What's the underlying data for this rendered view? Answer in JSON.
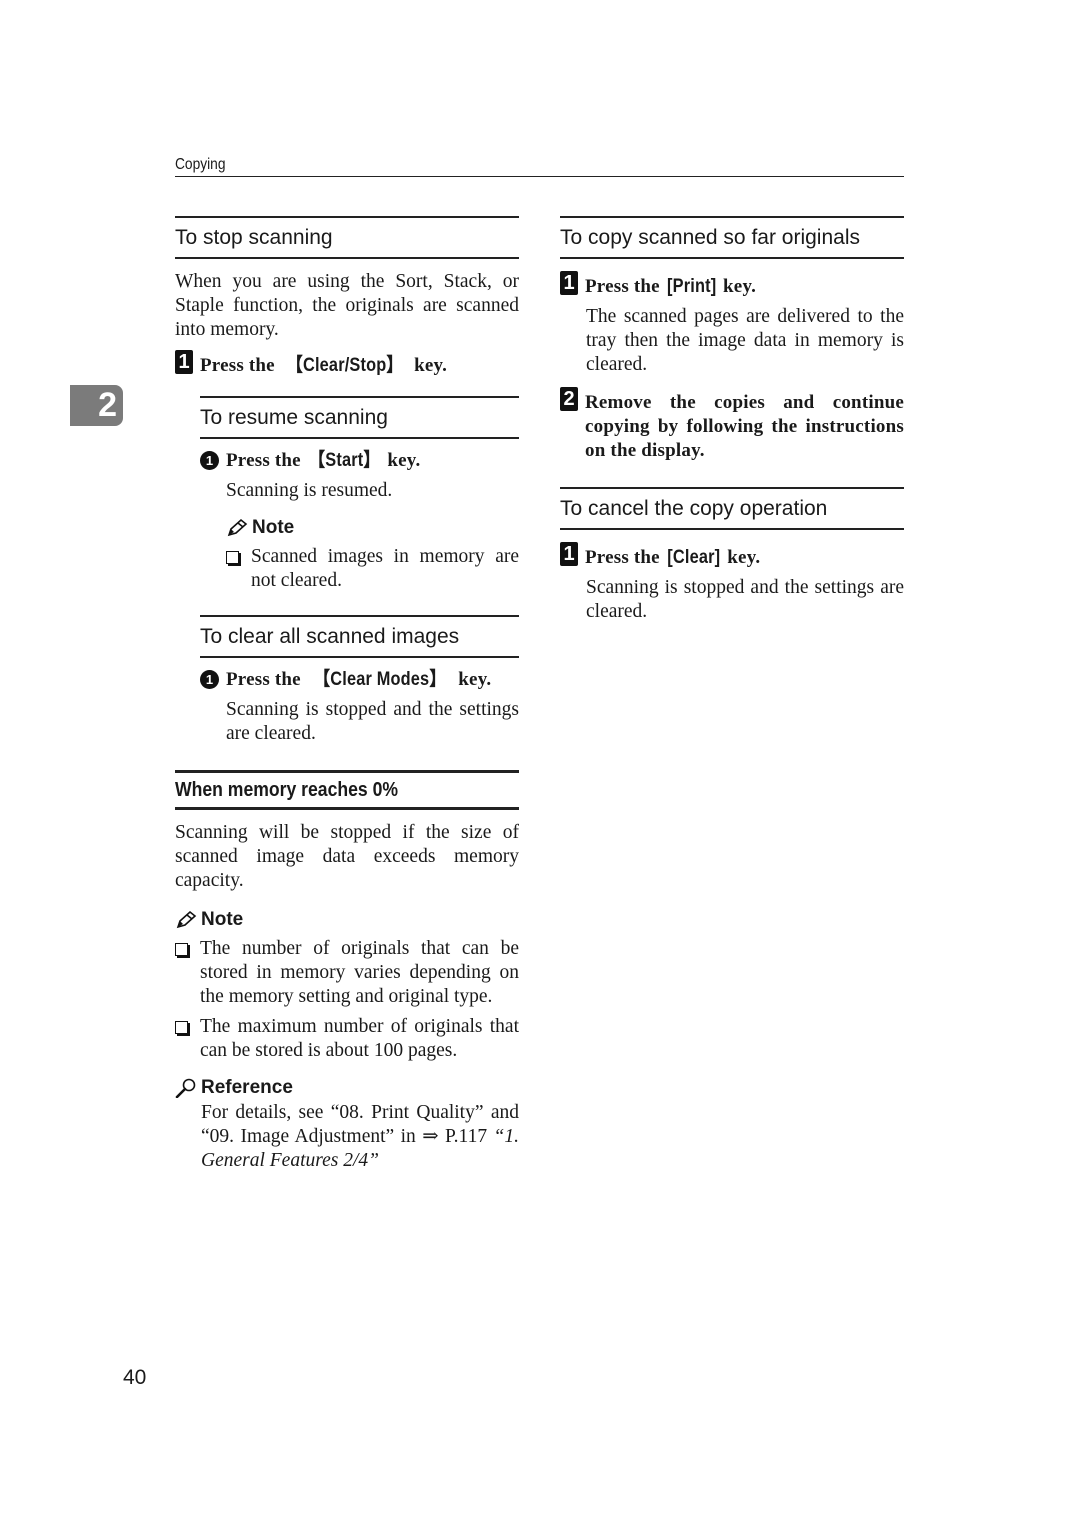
{
  "running_head": "Copying",
  "chapter_tab": "2",
  "page_number": "40",
  "left_column": {
    "stop_scanning": {
      "heading": "To stop scanning",
      "intro": "When you are using the Sort, Stack, or Staple function, the originals are scanned into memory.",
      "step1": {
        "num": "1",
        "prefix": "Press the ",
        "key": "【Clear/Stop】",
        "suffix": " key."
      }
    },
    "resume_scanning": {
      "heading": "To resume scanning",
      "step1": {
        "num": "1",
        "prefix": "Press the ",
        "key": "【Start】",
        "suffix": " key."
      },
      "result": "Scanning is resumed.",
      "note_label": "Note",
      "note_items": [
        "Scanned images in memory are not cleared."
      ]
    },
    "clear_all": {
      "heading": "To clear all scanned images",
      "step1": {
        "num": "1",
        "prefix": "Press the ",
        "key": "【Clear Modes】",
        "suffix": " key."
      },
      "result": "Scanning is stopped and the settings are cleared."
    },
    "memory_zero": {
      "heading": "When memory reaches 0%",
      "intro": "Scanning will be stopped if the size of scanned image data exceeds memory capacity.",
      "note_label": "Note",
      "note_items": [
        "The number of originals that can be stored in memory varies depending on the memory setting and original type.",
        "The maximum number of originals that can be stored is about 100 pages."
      ],
      "reference_label": "Reference",
      "reference_text": "For details, see “08. Print Quality” and “09. Image Adjustment” in ⇒ P.117 ",
      "reference_link": "“1. General Features 2/4”"
    }
  },
  "right_column": {
    "copy_scanned": {
      "heading": "To copy scanned so far originals",
      "step1": {
        "num": "1",
        "prefix": "Press the ",
        "key": "[Print]",
        "suffix": " key."
      },
      "step1_result": "The scanned pages are delivered to the tray then the image data in memory is cleared.",
      "step2": {
        "num": "2",
        "text": "Remove the copies and continue copying by following the instructions on the display."
      }
    },
    "cancel_copy": {
      "heading": "To cancel the copy operation",
      "step1": {
        "num": "1",
        "prefix": "Press the ",
        "key": "[Clear]",
        "suffix": " key."
      },
      "result": "Scanning is stopped and the settings are cleared."
    }
  }
}
